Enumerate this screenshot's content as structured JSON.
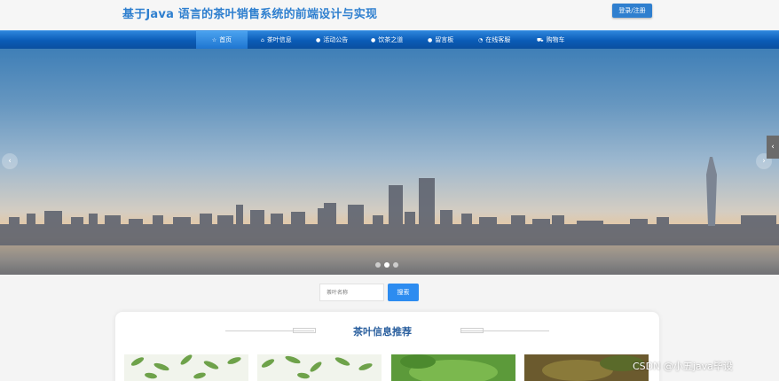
{
  "header": {
    "title": "基于Java 语言的茶叶销售系统的前端设计与实现",
    "login_label": "登录/注册"
  },
  "nav": {
    "items": [
      {
        "label": "首页",
        "icon": "star-icon",
        "active": true
      },
      {
        "label": "茶叶信息",
        "icon": "home-icon"
      },
      {
        "label": "活动公告",
        "icon": "info-icon"
      },
      {
        "label": "饮茶之道",
        "icon": "info-icon"
      },
      {
        "label": "留言板",
        "icon": "info-icon"
      },
      {
        "label": "在线客服",
        "icon": "headset-icon"
      },
      {
        "label": "购物车",
        "icon": "cart-icon"
      }
    ]
  },
  "banner": {
    "prev_arrow": "‹",
    "next_arrow": "›",
    "side_tab": "‹",
    "dots": 3,
    "active_dot": 2
  },
  "search": {
    "placeholder": "茶叶名称",
    "button_label": "搜索"
  },
  "section": {
    "title": "茶叶信息推荐"
  },
  "watermark": "CSDN @小五java毕设",
  "colors": {
    "accent": "#2d8cf0",
    "nav": "#0a5bb6",
    "title": "#2e7fcf"
  }
}
